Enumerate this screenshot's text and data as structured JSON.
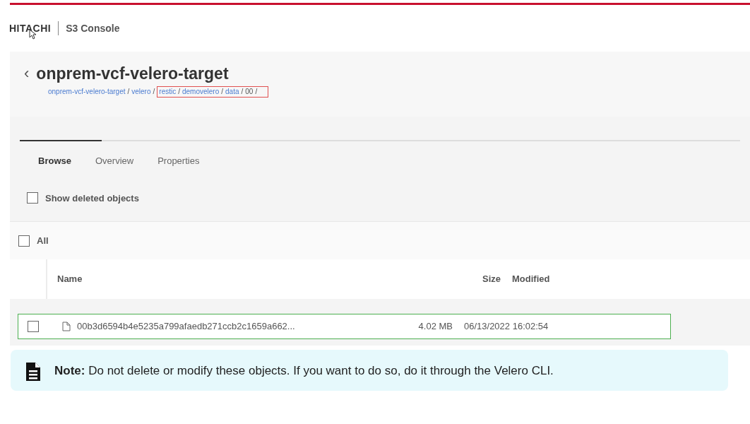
{
  "header": {
    "logo": "HITACHI",
    "app_name": "S3 Console"
  },
  "bucket": {
    "back": "‹",
    "title": "onprem-vcf-velero-target",
    "separator": "/",
    "breadcrumb": [
      {
        "label": "onprem-vcf-velero-target",
        "link": true,
        "highlighted": false
      },
      {
        "label": "velero",
        "link": true,
        "highlighted": false
      },
      {
        "label": "restic",
        "link": true,
        "highlighted": true
      },
      {
        "label": "demovelero",
        "link": true,
        "highlighted": true
      },
      {
        "label": "data",
        "link": true,
        "highlighted": true
      },
      {
        "label": "00",
        "link": false,
        "highlighted": true
      }
    ]
  },
  "tabs": [
    {
      "label": "Browse",
      "selected": true
    },
    {
      "label": "Overview",
      "selected": false
    },
    {
      "label": "Properties",
      "selected": false
    }
  ],
  "show_deleted": {
    "label": "Show deleted objects",
    "checked": false
  },
  "select_all": {
    "label": "All",
    "checked": false
  },
  "table": {
    "columns": [
      "Name",
      "Size",
      "Modified"
    ],
    "rows": [
      {
        "checked": false,
        "highlighted": true,
        "name": "00b3d6594b4e5235a799afaedb271ccb2c1659a662...",
        "size": "4.02 MB",
        "modified": "06/13/2022 16:02:54"
      }
    ]
  },
  "note": {
    "text": "**Note:** Do not delete or modify these objects. If you want to do so, do it through the Velero CLI."
  }
}
